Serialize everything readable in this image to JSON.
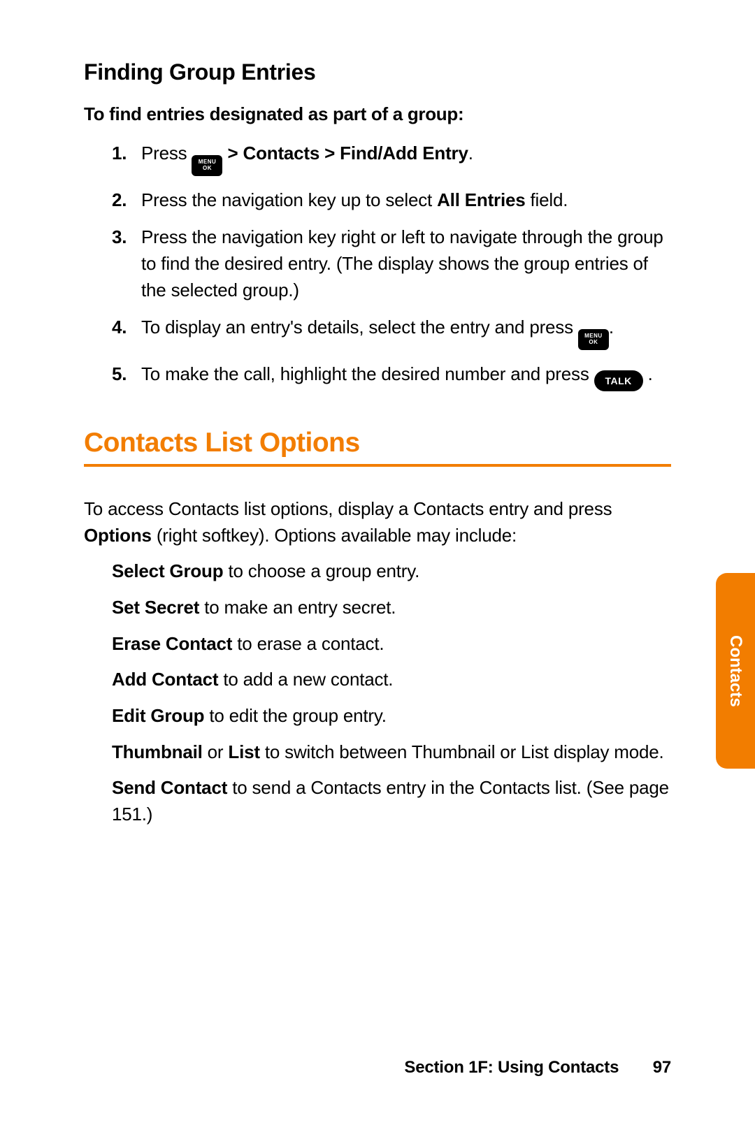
{
  "heading_sub": "Finding Group Entries",
  "intro": "To find entries designated as part of a group:",
  "icons": {
    "menu_top": "MENU",
    "menu_bottom": "OK",
    "talk": "TALK"
  },
  "steps": [
    {
      "num": "1.",
      "pre": "Press ",
      "icon": "menu",
      "post_bold": " > Contacts > Find/Add Entry",
      "tail": "."
    },
    {
      "num": "2.",
      "text_a": "Press the navigation key up to select ",
      "bold": "All Entries",
      "text_b": " field."
    },
    {
      "num": "3.",
      "text": "Press the navigation key right or left to navigate through the group to find the desired entry. (The display shows the group entries of the selected group.)"
    },
    {
      "num": "4.",
      "text_a": "To display an entry's details, select the entry and press ",
      "icon": "menu",
      "text_b": "."
    },
    {
      "num": "5.",
      "text_a": "To make the call, highlight the desired number and press ",
      "icon": "talk",
      "text_b": " ."
    }
  ],
  "heading_major": "Contacts List Options",
  "para_a": "To access Contacts list options, display a Contacts entry and press ",
  "para_bold": "Options",
  "para_b": " (right softkey). Options available may include:",
  "options": [
    {
      "bold": "Select Group",
      "text": " to choose a group entry."
    },
    {
      "bold": "Set Secret",
      "text": " to make an entry secret."
    },
    {
      "bold": "Erase Contact",
      "text": " to erase a contact."
    },
    {
      "bold": "Add Contact",
      "text": " to add a new contact."
    },
    {
      "bold": "Edit Group",
      "text": " to edit the group entry."
    },
    {
      "bold": "Thumbnail",
      "mid": " or ",
      "bold2": "List",
      "text": " to switch between Thumbnail or List display mode."
    },
    {
      "bold": "Send Contact",
      "text": " to send a Contacts entry in the Contacts list. (See page 151.)"
    }
  ],
  "side_tab": "Contacts",
  "footer_section": "Section 1F: Using Contacts",
  "footer_page": "97"
}
